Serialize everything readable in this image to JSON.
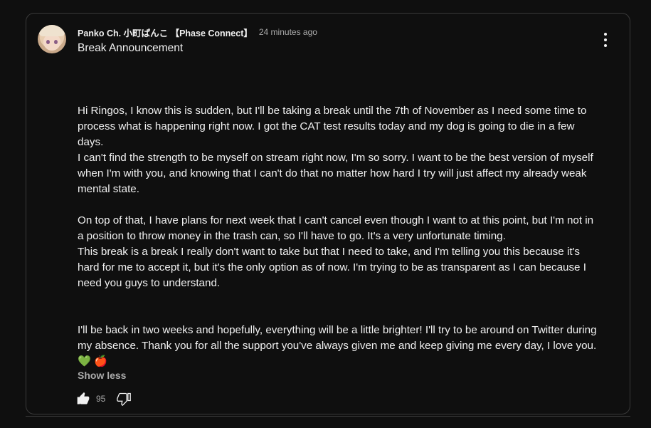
{
  "post": {
    "author": "Panko Ch. 小町ぱんこ 【Phase Connect】",
    "time": "24 minutes ago",
    "title": "Break Announcement",
    "paragraphs": {
      "p1": "Hi Ringos, I know this is sudden, but I'll be taking a break until the 7th of November as I need some time to process what is happening right now. I got the CAT test results today and my dog is going to die in a few days.",
      "p2": "I can't find the strength to be myself on stream right now, I'm so sorry. I want to be the best version of myself when I'm with you, and knowing that I can't do that no matter how hard I try will just affect my already weak mental state.",
      "p3": "On top of that, I have plans for next week that I can't cancel even though I want to at this point, but I'm not in a position to throw money in the trash can, so I'll have to go. It's a very unfortunate timing.",
      "p4": "This break is a break I really don't want to take but that I need to take, and I'm telling you this because it's hard for me to accept it, but it's the only option as of now. I'm trying to be as transparent as I can because I need you guys to understand.",
      "p5": "I'll be back in two weeks and hopefully, everything will be a little brighter! I'll try to be around on Twitter during my absence. Thank you for all the support you've always given me and keep giving me every day, I love you. 💚 🍎"
    },
    "show_less_label": "Show less",
    "like_count": "95"
  },
  "icons": {
    "like": "thumbs-up-icon",
    "dislike": "thumbs-down-icon",
    "menu": "more-vert-icon"
  },
  "colors": {
    "background": "#0f0f0f",
    "text": "#f1f1f1",
    "secondary_text": "#aaaaaa",
    "border": "#3a3a3a"
  }
}
